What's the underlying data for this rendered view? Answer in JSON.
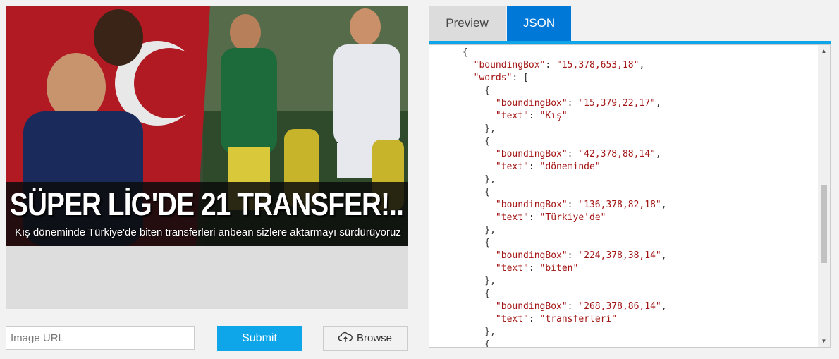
{
  "image": {
    "headline": "SÜPER LİG'DE 21 TRANSFER!..",
    "subheadline": "Kış döneminde Türkiye'de biten transferleri anbean sizlere aktarmayı sürdürüyoruz"
  },
  "form": {
    "url_placeholder": "Image URL",
    "submit_label": "Submit",
    "browse_label": "Browse",
    "browse_icon": "cloud-upload-icon"
  },
  "tabs": [
    {
      "label": "Preview",
      "active": false
    },
    {
      "label": "JSON",
      "active": true
    }
  ],
  "json_lines": [
    {
      "indent": "      ",
      "text": "{"
    },
    {
      "indent": "        ",
      "key": "\"boundingBox\"",
      "sep": ": ",
      "val": "\"15,378,653,18\"",
      "tail": ","
    },
    {
      "indent": "        ",
      "key": "\"words\"",
      "sep": ": ",
      "val": "",
      "tail": "["
    },
    {
      "indent": "          ",
      "text": "{"
    },
    {
      "indent": "            ",
      "key": "\"boundingBox\"",
      "sep": ": ",
      "val": "\"15,379,22,17\"",
      "tail": ","
    },
    {
      "indent": "            ",
      "key": "\"text\"",
      "sep": ": ",
      "val": "\"Kış\"",
      "tail": ""
    },
    {
      "indent": "          ",
      "text": "},"
    },
    {
      "indent": "          ",
      "text": "{"
    },
    {
      "indent": "            ",
      "key": "\"boundingBox\"",
      "sep": ": ",
      "val": "\"42,378,88,14\"",
      "tail": ","
    },
    {
      "indent": "            ",
      "key": "\"text\"",
      "sep": ": ",
      "val": "\"döneminde\"",
      "tail": ""
    },
    {
      "indent": "          ",
      "text": "},"
    },
    {
      "indent": "          ",
      "text": "{"
    },
    {
      "indent": "            ",
      "key": "\"boundingBox\"",
      "sep": ": ",
      "val": "\"136,378,82,18\"",
      "tail": ","
    },
    {
      "indent": "            ",
      "key": "\"text\"",
      "sep": ": ",
      "val": "\"Türkiye'de\"",
      "tail": ""
    },
    {
      "indent": "          ",
      "text": "},"
    },
    {
      "indent": "          ",
      "text": "{"
    },
    {
      "indent": "            ",
      "key": "\"boundingBox\"",
      "sep": ": ",
      "val": "\"224,378,38,14\"",
      "tail": ","
    },
    {
      "indent": "            ",
      "key": "\"text\"",
      "sep": ": ",
      "val": "\"biten\"",
      "tail": ""
    },
    {
      "indent": "          ",
      "text": "},"
    },
    {
      "indent": "          ",
      "text": "{"
    },
    {
      "indent": "            ",
      "key": "\"boundingBox\"",
      "sep": ": ",
      "val": "\"268,378,86,14\"",
      "tail": ","
    },
    {
      "indent": "            ",
      "key": "\"text\"",
      "sep": ": ",
      "val": "\"transferleri\"",
      "tail": ""
    },
    {
      "indent": "          ",
      "text": "},"
    },
    {
      "indent": "          ",
      "text": "{"
    }
  ],
  "colors": {
    "accent": "#0ea5e9",
    "tab_active": "#0078d7",
    "json_string": "#a31515"
  }
}
